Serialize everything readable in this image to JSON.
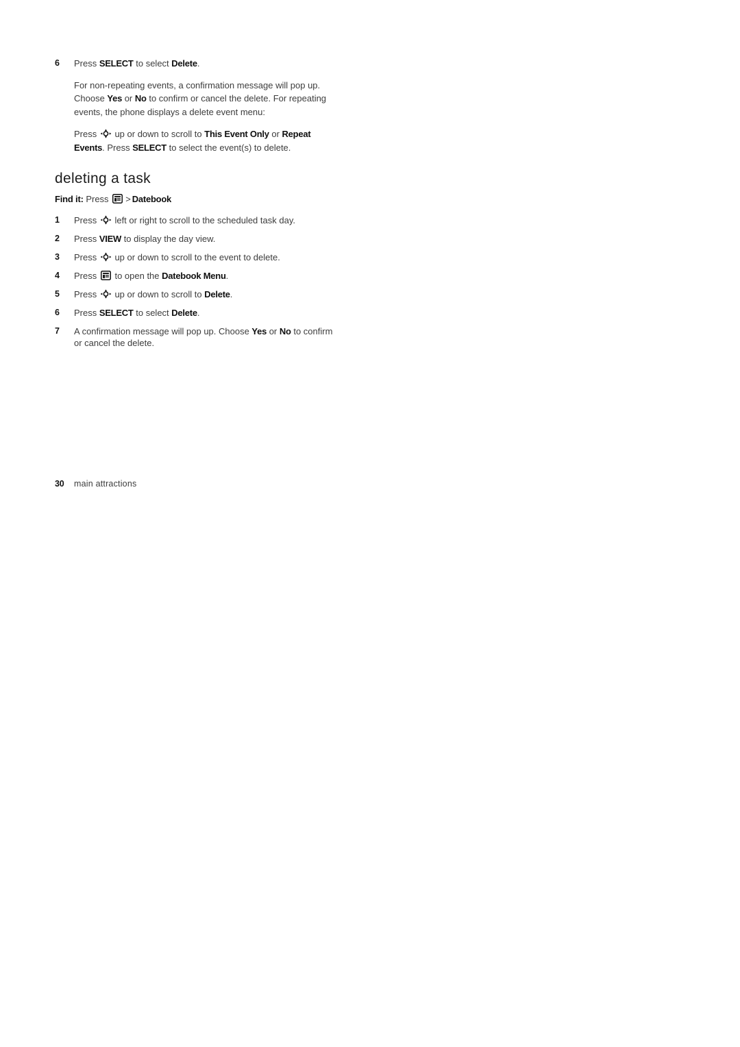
{
  "page": {
    "background_color": "#ffffff",
    "text_color": "#3c3c3c",
    "bold_color": "#101010"
  },
  "continued_step": {
    "number": "6",
    "text_before": "Press ",
    "keyword_1": "SELECT",
    "text_middle": " to select ",
    "keyword_2": "Delete",
    "text_after": "."
  },
  "paragraphs": {
    "p1_a": "For non-repeating events, a confirmation message will pop up. Choose ",
    "p1_yes": "Yes",
    "p1_or": " or ",
    "p1_no": "No",
    "p1_b": " to confirm or cancel the delete. For repeating events, the phone displays a delete event menu:",
    "p2_a": "Press ",
    "p2_b": " up or down to scroll to ",
    "p2_this_event_only": "This Event Only",
    "p2_c": " or ",
    "p2_repeat_events": "Repeat Events",
    "p2_d": ". Press ",
    "p2_select": "SELECT",
    "p2_e": " to select the event(s) to delete."
  },
  "section": {
    "heading": "deleting a task",
    "find_it": {
      "label": "Find it:",
      "press": " Press ",
      "menu_icon": "menu-icon",
      "separator": ">",
      "destination": "Datebook"
    }
  },
  "steps": [
    {
      "number": "1",
      "parts": [
        {
          "type": "text",
          "value": "Press "
        },
        {
          "type": "icon",
          "value": "nav-key-icon"
        },
        {
          "type": "text",
          "value": " left or right to scroll to the scheduled task day."
        }
      ]
    },
    {
      "number": "2",
      "parts": [
        {
          "type": "text",
          "value": "Press "
        },
        {
          "type": "bold",
          "value": "VIEW"
        },
        {
          "type": "text",
          "value": " to display the day view."
        }
      ]
    },
    {
      "number": "3",
      "parts": [
        {
          "type": "text",
          "value": "Press "
        },
        {
          "type": "icon",
          "value": "nav-key-icon"
        },
        {
          "type": "text",
          "value": " up or down to scroll to the event to delete."
        }
      ]
    },
    {
      "number": "4",
      "parts": [
        {
          "type": "text",
          "value": "Press "
        },
        {
          "type": "icon",
          "value": "menu-icon"
        },
        {
          "type": "text",
          "value": " to open the "
        },
        {
          "type": "bold",
          "value": "Datebook Menu"
        },
        {
          "type": "text",
          "value": "."
        }
      ]
    },
    {
      "number": "5",
      "parts": [
        {
          "type": "text",
          "value": "Press "
        },
        {
          "type": "icon",
          "value": "nav-key-icon"
        },
        {
          "type": "text",
          "value": " up or down to scroll to "
        },
        {
          "type": "bold",
          "value": "Delete"
        },
        {
          "type": "text",
          "value": "."
        }
      ]
    },
    {
      "number": "6",
      "parts": [
        {
          "type": "text",
          "value": "Press "
        },
        {
          "type": "bold",
          "value": "SELECT"
        },
        {
          "type": "text",
          "value": " to select "
        },
        {
          "type": "bold",
          "value": "Delete"
        },
        {
          "type": "text",
          "value": "."
        }
      ]
    },
    {
      "number": "7",
      "parts": [
        {
          "type": "text",
          "value": "A confirmation message will pop up. Choose "
        },
        {
          "type": "bold",
          "value": "Yes"
        },
        {
          "type": "text",
          "value": " or "
        },
        {
          "type": "bold",
          "value": "No"
        },
        {
          "type": "text",
          "value": " to confirm or cancel the delete."
        }
      ]
    }
  ],
  "footer": {
    "page_number": "30",
    "section_label": "main attractions"
  }
}
